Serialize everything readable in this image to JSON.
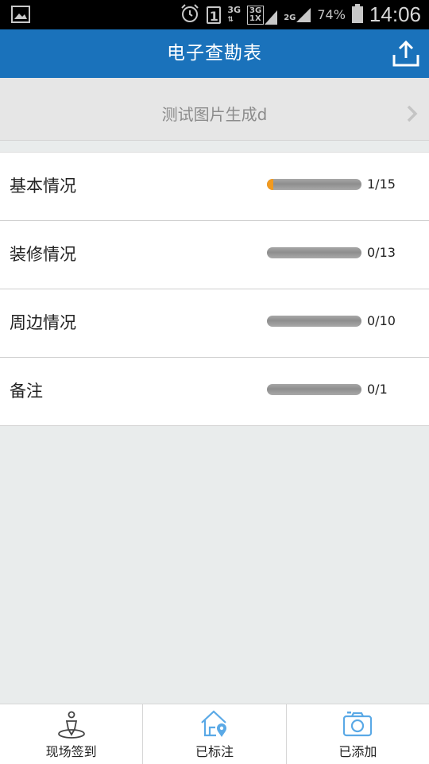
{
  "status_bar": {
    "network_1": "3G",
    "network_2_top": "3G",
    "network_2_bottom": "1X",
    "network_3": "2G",
    "sim_slot": "1",
    "battery": "74%",
    "time": "14:06"
  },
  "header": {
    "title": "电子查勘表",
    "upload_icon": "upload-icon"
  },
  "project": {
    "name": "测试图片生成d"
  },
  "sections": [
    {
      "label": "基本情况",
      "count": "1/15",
      "progress": 0.0667
    },
    {
      "label": "装修情况",
      "count": "0/13",
      "progress": 0
    },
    {
      "label": "周边情况",
      "count": "0/10",
      "progress": 0
    },
    {
      "label": "备注",
      "count": "0/1",
      "progress": 0
    }
  ],
  "bottom_tabs": [
    {
      "label": "现场签到",
      "icon": "location-person-icon"
    },
    {
      "label": "已标注",
      "icon": "home-pin-icon"
    },
    {
      "label": "已添加",
      "icon": "camera-icon"
    }
  ],
  "colors": {
    "header": "#1a72bb",
    "progress_fill": "#f29a1f",
    "tab_icon_blue": "#5aa9e6"
  }
}
